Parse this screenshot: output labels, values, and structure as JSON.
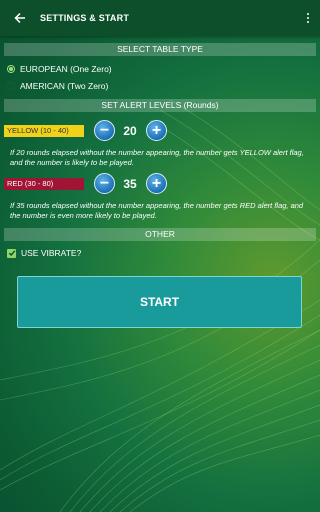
{
  "appbar": {
    "title": "SETTINGS & START",
    "back_icon": "arrow-back-icon",
    "menu_icon": "more-vert-icon"
  },
  "table_type": {
    "header": "SELECT TABLE TYPE",
    "options": [
      {
        "label": "EUROPEAN (One Zero)",
        "selected": true
      },
      {
        "label": "AMERICAN (Two Zero)",
        "selected": false
      }
    ]
  },
  "alert_levels": {
    "header": "SET ALERT LEVELS (Rounds)",
    "yellow": {
      "label": "YELLOW (10 - 40)",
      "value": "20",
      "color": "#f1d21a",
      "description": "If 20 rounds elapsed without the number appearing, the number gets YELLOW alert flag, and the number is likely to be played."
    },
    "red": {
      "label": "RED (30 - 80)",
      "value": "35",
      "color": "#a01535",
      "description": "If 35 rounds elapsed without the number appearing, the number gets RED alert flag, and the number is even more likely to be played."
    },
    "decrement_symbol": "−",
    "increment_symbol": "+"
  },
  "other": {
    "header": "OTHER",
    "vibrate_label": "USE VIBRATE?",
    "vibrate_checked": true
  },
  "start_button": {
    "label": "START"
  }
}
